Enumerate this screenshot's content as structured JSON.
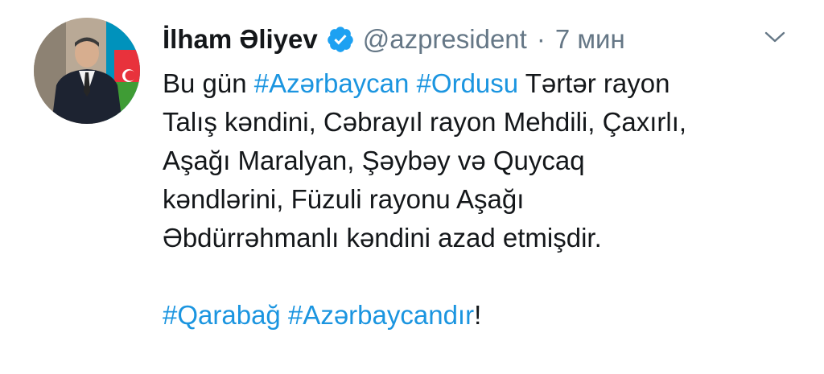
{
  "tweet": {
    "author_name": "İlham Əliyev",
    "handle": "@azpresident",
    "separator": "·",
    "time": "7 мин",
    "line1": {
      "text_start": "Bu gün ",
      "hashtag1": "#Azərbaycan",
      "space": " ",
      "hashtag2": "#Ordusu",
      "text_end": " Tərtər rayon"
    },
    "line2": "Talış kəndini, Cəbrayıl rayon Mehdili, Çaxırlı,",
    "line3": "Aşağı Maralyan, Şəybəy və Quycaq",
    "line4": "kəndlərini, Füzuli rayonu Aşağı",
    "line5": "Əbdürrəhmanlı kəndini azad etmişdir.",
    "last_line": {
      "hashtag1": "#Qarabağ",
      "space": " ",
      "hashtag2": "#Azərbaycandır",
      "suffix": "!"
    }
  },
  "icons": {
    "verified": "verified-badge-icon",
    "menu": "chevron-down-icon"
  },
  "colors": {
    "text": "#14171a",
    "secondary": "#657786",
    "link": "#1b95e0",
    "verified": "#1da1f2"
  }
}
